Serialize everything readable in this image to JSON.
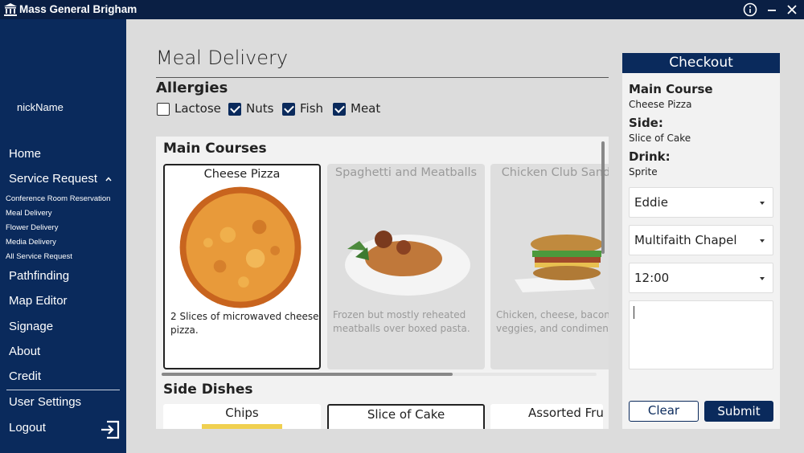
{
  "window": {
    "title": "Mass General Brigham",
    "icons": [
      "bank-building-icon",
      "info-icon",
      "minimize-icon",
      "close-icon"
    ]
  },
  "sidebar": {
    "username": "nickName",
    "nav": {
      "home": "Home",
      "service_request": "Service Request",
      "pathfinding": "Pathfinding",
      "map_editor": "Map Editor",
      "signage": "Signage",
      "about": "About",
      "credit": "Credit",
      "user_settings": "User Settings",
      "logout": "Logout"
    },
    "service_sub": {
      "conference": "Conference Room Reservation",
      "meal": "Meal Delivery",
      "flower": "Flower Delivery",
      "media": "Media Delivery",
      "all": "All Service Request"
    }
  },
  "page": {
    "title": "Meal Delivery",
    "allergies_title": "Allergies",
    "allergies": [
      {
        "label": "Lactose",
        "checked": false
      },
      {
        "label": "Nuts",
        "checked": true
      },
      {
        "label": "Fish",
        "checked": true
      },
      {
        "label": "Meat",
        "checked": true
      }
    ]
  },
  "menu": {
    "main_title": "Main Courses",
    "main_items": [
      {
        "name": "Cheese Pizza",
        "desc": "2 Slices of microwaved cheese pizza.",
        "selected": true
      },
      {
        "name": "Spaghetti and Meatballs",
        "desc": "Frozen but mostly reheated meatballs over boxed pasta.",
        "selected": false
      },
      {
        "name": "Chicken Club Sandwich",
        "desc": "Chicken, cheese, bacon, veggies, and condiments.",
        "selected": false
      }
    ],
    "side_title": "Side Dishes",
    "side_items": [
      {
        "name": "Chips"
      },
      {
        "name": "Slice of Cake"
      },
      {
        "name": "Assorted Fruit"
      }
    ]
  },
  "checkout": {
    "title": "Checkout",
    "main_label": "Main Course",
    "main_value": "Cheese Pizza",
    "side_label": "Side:",
    "side_value": "Slice of Cake",
    "drink_label": "Drink:",
    "drink_value": "Sprite",
    "employee": "Eddie",
    "location": "Multifaith Chapel",
    "time": "12:00",
    "notes": "",
    "clear": "Clear",
    "submit": "Submit"
  },
  "colors": {
    "navy": "#0a2a5c",
    "titlebar": "#0a1f44",
    "panel": "#f2f2f2",
    "background": "#dcdcdc"
  }
}
